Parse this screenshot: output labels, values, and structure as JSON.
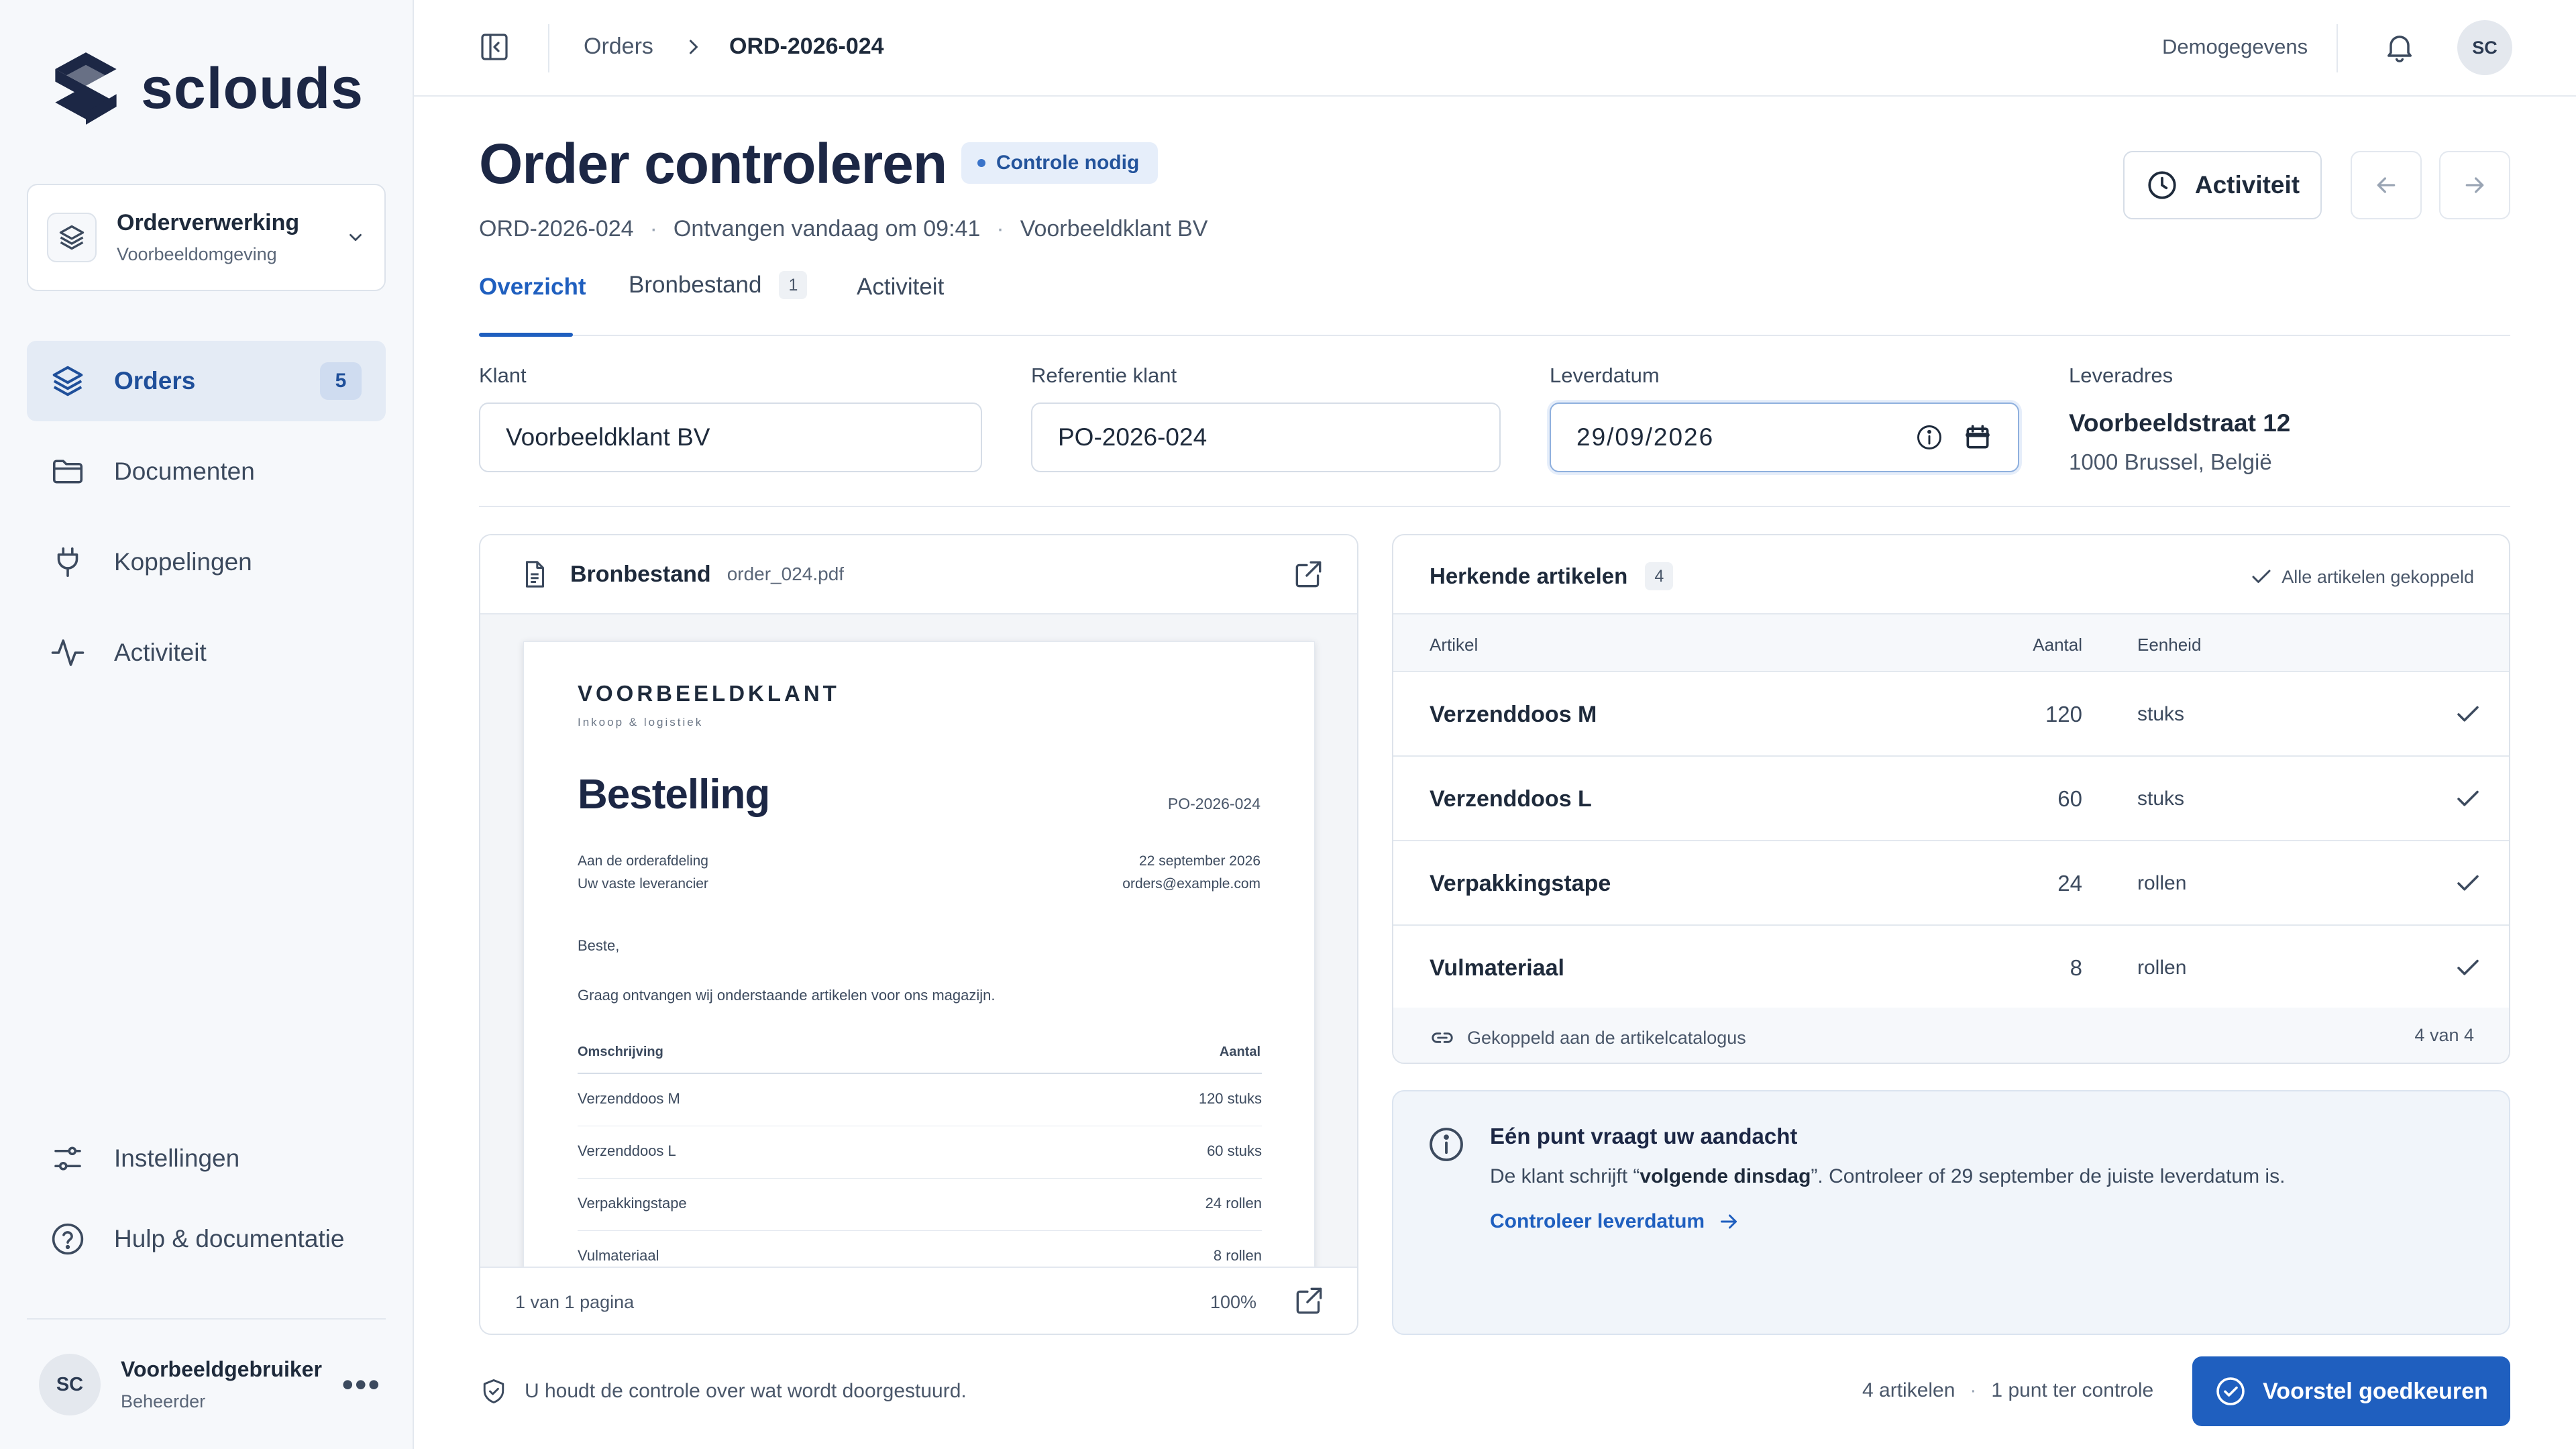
{
  "app": {
    "brand": "sclouds"
  },
  "workspace": {
    "title": "Orderverwerking",
    "subtitle": "Voorbeeldomgeving"
  },
  "sidebar": {
    "items": [
      {
        "label": "Orders",
        "badge": "5",
        "icon": "layers-icon",
        "active": true
      },
      {
        "label": "Documenten",
        "icon": "folder-icon"
      },
      {
        "label": "Koppelingen",
        "icon": "plug-icon"
      },
      {
        "label": "Activiteit",
        "icon": "activity-icon"
      }
    ],
    "bottom": [
      {
        "label": "Instellingen",
        "icon": "sliders-icon"
      },
      {
        "label": "Hulp & documentatie",
        "icon": "help-icon"
      }
    ],
    "user": {
      "initials": "SC",
      "name": "Voorbeeldgebruiker",
      "role": "Beheerder"
    }
  },
  "topbar": {
    "breadcrumb": [
      "Orders",
      "ORD-2026-024"
    ],
    "demo_label": "Demogegevens",
    "avatar": "SC"
  },
  "header": {
    "title": "Order controleren",
    "status": "Controle nodig",
    "meta": [
      "ORD-2026-024",
      "Ontvangen vandaag om 09:41",
      "Voorbeeldklant BV"
    ],
    "activity_button": "Activiteit"
  },
  "tabs": [
    {
      "label": "Overzicht",
      "active": true
    },
    {
      "label": "Bronbestand",
      "badge": "1"
    },
    {
      "label": "Activiteit"
    }
  ],
  "form": {
    "klant": {
      "label": "Klant",
      "value": "Voorbeeldklant BV"
    },
    "referentie": {
      "label": "Referentie klant",
      "value": "PO-2026-024"
    },
    "leverdatum": {
      "label": "Leverdatum",
      "value": "29/09/2026"
    },
    "leveradres": {
      "label": "Leveradres",
      "line1": "Voorbeeldstraat 12",
      "line2": "1000 Brussel, België"
    }
  },
  "source": {
    "title": "Bronbestand",
    "filename": "order_024.pdf",
    "footer_pages": "1 van 1 pagina",
    "footer_zoom": "100%",
    "document": {
      "brand": "VOORBEELDKLANT",
      "tagline": "Inkoop & logistiek",
      "title": "Bestelling",
      "ref": "PO-2026-024",
      "to_line1": "Aan de orderafdeling",
      "to_line2": "Uw vaste leverancier",
      "date": "22 september 2026",
      "email": "orders@example.com",
      "greeting": "Beste,",
      "body": "Graag ontvangen wij onderstaande artikelen voor ons magazijn.",
      "col_desc": "Omschrijving",
      "col_qty": "Aantal",
      "rows": [
        {
          "desc": "Verzenddoos M",
          "qty": "120 stuks"
        },
        {
          "desc": "Verzenddoos L",
          "qty": "60 stuks"
        },
        {
          "desc": "Verpakkingstape",
          "qty": "24 rollen"
        },
        {
          "desc": "Vulmateriaal",
          "qty": "8 rollen"
        }
      ]
    }
  },
  "articles": {
    "title": "Herkende artikelen",
    "count": "4",
    "status": "Alle artikelen gekoppeld",
    "columns": {
      "article": "Artikel",
      "qty": "Aantal",
      "unit": "Eenheid"
    },
    "rows": [
      {
        "name": "Verzenddoos M",
        "qty": "120",
        "unit": "stuks"
      },
      {
        "name": "Verzenddoos L",
        "qty": "60",
        "unit": "stuks"
      },
      {
        "name": "Verpakkingstape",
        "qty": "24",
        "unit": "rollen"
      },
      {
        "name": "Vulmateriaal",
        "qty": "8",
        "unit": "rollen"
      }
    ],
    "footer_link": "Gekoppeld aan de artikelcatalogus",
    "footer_count": "4 van 4"
  },
  "notice": {
    "title": "Eén punt vraagt uw aandacht",
    "text_before": "De klant schrijft “",
    "text_bold": "volgende dinsdag",
    "text_after": "”. Controleer of 29 september de juiste leverdatum is.",
    "link": "Controleer leverdatum"
  },
  "footer": {
    "note": "U houdt de controle over wat wordt doorgestuurd.",
    "articles": "4 artikelen",
    "points": "1 punt ter controle",
    "approve": "Voorstel goedkeuren"
  },
  "colors": {
    "accent": "#1f5fbf",
    "brand": "#1c2745",
    "status_bg": "#e6eefa"
  }
}
